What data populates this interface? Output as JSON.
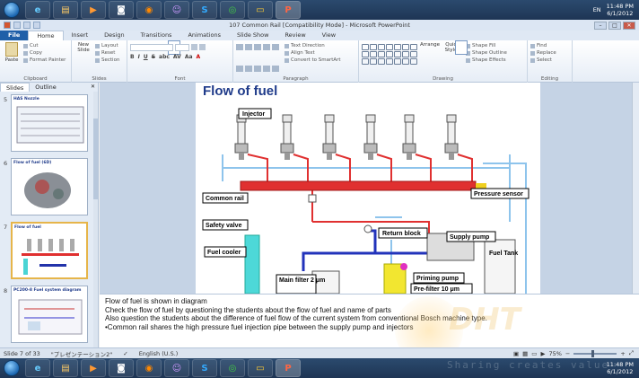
{
  "taskbar_top": {
    "apps": [
      "start",
      "ie",
      "explorer",
      "media",
      "camera",
      "firefox",
      "chat",
      "skype",
      "chrome",
      "folder",
      "powerpoint"
    ],
    "lang": "EN",
    "time": "11:48 PM",
    "date": "6/1/2012"
  },
  "window": {
    "title": "107 Common Rail [Compatibility Mode] - Microsoft PowerPoint"
  },
  "ribbon": {
    "tabs": [
      "File",
      "Home",
      "Insert",
      "Design",
      "Transitions",
      "Animations",
      "Slide Show",
      "Review",
      "View"
    ],
    "clipboard": {
      "paste": "Paste",
      "cut": "Cut",
      "copy": "Copy",
      "format_painter": "Format Painter",
      "label": "Clipboard"
    },
    "slides": {
      "new_slide": "New Slide",
      "layout": "Layout",
      "reset": "Reset",
      "section": "Section",
      "label": "Slides"
    },
    "font": {
      "label": "Font",
      "bold": "B",
      "italic": "I",
      "underline": "U",
      "strike": "S",
      "shadow": "abc",
      "spacing": "AV",
      "case": "Aa"
    },
    "paragraph": {
      "label": "Paragraph",
      "text_direction": "Text Direction",
      "align_text": "Align Text",
      "smartart": "Convert to SmartArt"
    },
    "drawing": {
      "label": "Drawing",
      "arrange": "Arrange",
      "quick_styles": "Quick Styles",
      "shape_fill": "Shape Fill",
      "shape_outline": "Shape Outline",
      "shape_effects": "Shape Effects"
    },
    "editing": {
      "label": "Editing",
      "find": "Find",
      "replace": "Replace",
      "select": "Select"
    }
  },
  "panel": {
    "tabs": [
      "Slides",
      "Outline"
    ],
    "thumbnails": [
      {
        "num": "5",
        "title": "HAS Nozzle"
      },
      {
        "num": "6",
        "title": "Flow of fuel (6D)"
      },
      {
        "num": "7",
        "title": "Flow of fuel"
      },
      {
        "num": "8",
        "title": "PC200-8 Fuel system diagram"
      }
    ]
  },
  "slide": {
    "title": "Flow of fuel",
    "labels": {
      "injector": "Injector",
      "common_rail": "Common rail",
      "pressure_sensor": "Pressure sensor",
      "safety_valve": "Safety valve",
      "return_block": "Return block",
      "supply_pump": "Supply pump",
      "fuel_cooler": "Fuel cooler",
      "fuel_tank": "Fuel Tank",
      "priming_pump": "Priming pump",
      "main_filter": "Main filter 2 μm",
      "pre_filter": "Pre-filter 10 μm"
    }
  },
  "notes": [
    "Flow of fuel is shown in diagram",
    "Check the flow of fuel by questioning the students about the flow of fuel and name of parts",
    "Also question the students about the difference of fuel flow of the current system from conventional Bosch machine type.",
    "•Common rail shares the high pressure fuel injection pipe between the supply pump and injectors"
  ],
  "status": {
    "slide_info": "Slide 7 of 33",
    "theme": "\"プレゼンテーション2\"",
    "language": "English (U.S.)",
    "zoom": "75%"
  },
  "taskbar_bottom": {
    "time": "11:48 PM",
    "date": "6/1/2012"
  },
  "watermark": {
    "logo": "DHT",
    "text": "Sharing creates value"
  }
}
